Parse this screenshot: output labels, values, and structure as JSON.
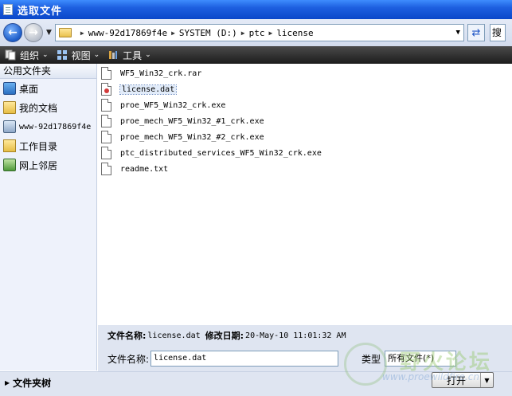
{
  "window": {
    "title": "选取文件"
  },
  "address": {
    "crumbs": [
      "www-92d17869f4e",
      "SYSTEM (D:)",
      "ptc",
      "license"
    ],
    "search_label": "搜"
  },
  "toolbar": {
    "organize": "组织",
    "views": "视图",
    "tools": "工具"
  },
  "sidebar": {
    "header": "公用文件夹",
    "items": [
      {
        "label": "桌面",
        "icon": "desktop-icon"
      },
      {
        "label": "我的文档",
        "icon": "documents-icon"
      },
      {
        "label": "www-92d17869f4e",
        "icon": "computer-icon"
      },
      {
        "label": "工作目录",
        "icon": "working-dir-icon"
      },
      {
        "label": "网上邻居",
        "icon": "network-icon"
      }
    ]
  },
  "files": [
    {
      "name": "WF5_Win32_crk.rar",
      "type": "file"
    },
    {
      "name": "license.dat",
      "type": "dat",
      "selected": true
    },
    {
      "name": "proe_WF5_Win32_crk.exe",
      "type": "file"
    },
    {
      "name": "proe_mech_WF5_Win32_#1_crk.exe",
      "type": "file"
    },
    {
      "name": "proe_mech_WF5_Win32_#2_crk.exe",
      "type": "file"
    },
    {
      "name": "ptc_distributed_services_WF5_Win32_crk.exe",
      "type": "file"
    },
    {
      "name": "readme.txt",
      "type": "file"
    }
  ],
  "info": {
    "filename_label": "文件名称:",
    "filename_value": "license.dat",
    "modified_label": "修改日期:",
    "modified_value": "20-May-10 11:01:32 AM"
  },
  "form": {
    "filename_label": "文件名称:",
    "filename_value": "license.dat",
    "type_label": "类型",
    "type_value": "所有文件(*)"
  },
  "bottom": {
    "folders_toggle": "文件夹树",
    "open_label": "打开"
  },
  "watermark": {
    "text": "野火论坛",
    "url": "www.proewildfire.cn"
  },
  "colors": {
    "title_bar": "#0a47c9",
    "toolbar": "#1c1c1c",
    "panel": "#dfe5f1"
  }
}
